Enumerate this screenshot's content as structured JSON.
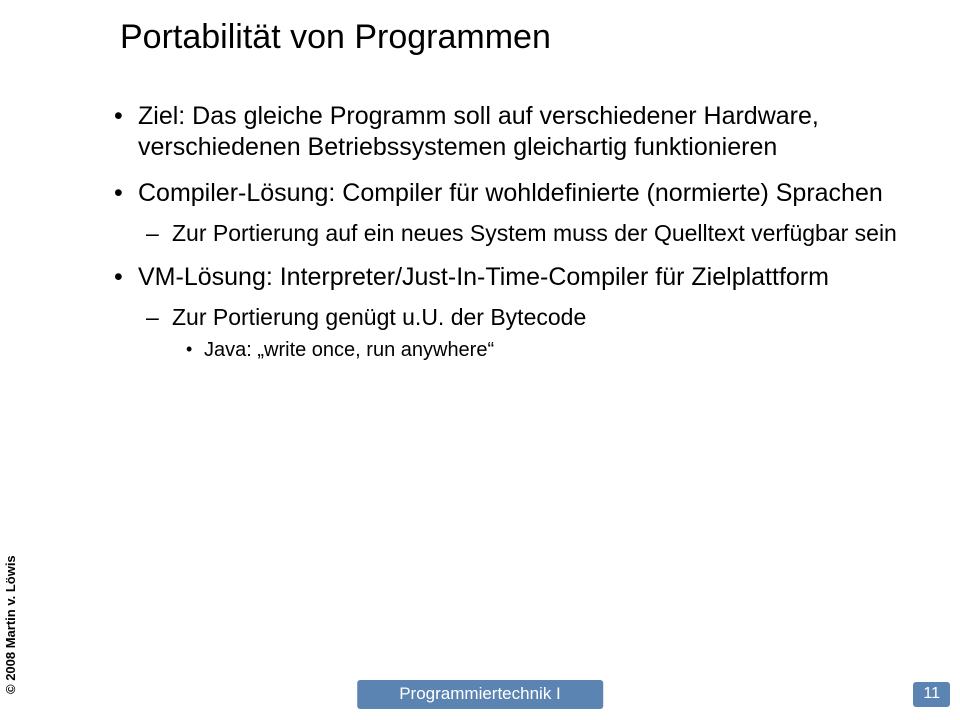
{
  "title": "Portabilität von Programmen",
  "bullets": {
    "b1": "Ziel: Das gleiche Programm soll auf verschiedener Hardware, verschiedenen Betriebssystemen gleichartig funktionieren",
    "b2": "Compiler-Lösung: Compiler für wohldefinierte (normierte) Sprachen",
    "b2_1": "Zur Portierung auf ein neues System muss der Quelltext verfügbar sein",
    "b3": "VM-Lösung: Interpreter/Just-In-Time-Compiler für Zielplattform",
    "b3_1": "Zur Portierung genügt u.U. der Bytecode",
    "b3_1_1": "Java: „write once, run anywhere“"
  },
  "copyright": "© 2008 Martin v. Löwis",
  "footer_center": "Programmiertechnik I",
  "footer_right": "11"
}
